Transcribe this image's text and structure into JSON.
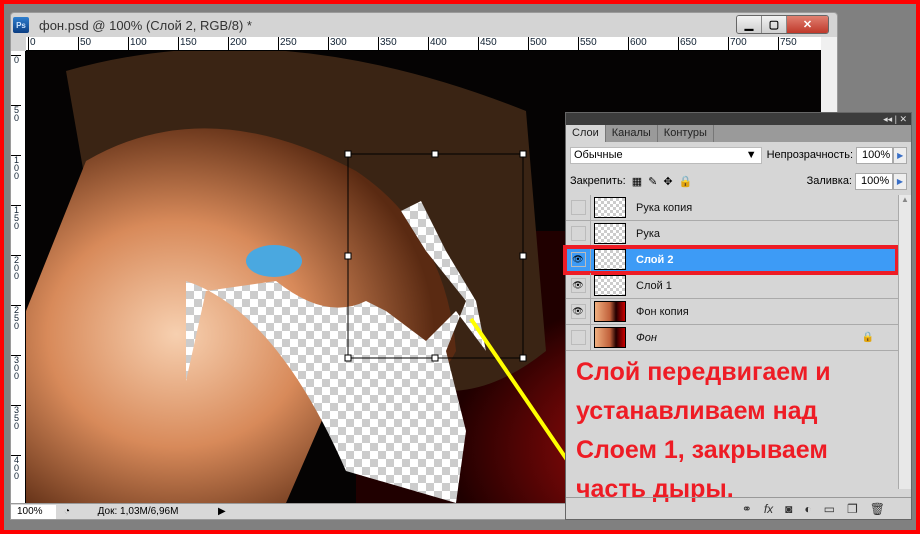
{
  "window": {
    "title": "фон.psd @ 100% (Слой 2, RGB/8) *",
    "app_icon": "Ps"
  },
  "ruler_top": [
    "0",
    "50",
    "100",
    "150",
    "200",
    "250",
    "300",
    "350",
    "400",
    "450",
    "500",
    "550",
    "600",
    "650",
    "700",
    "750"
  ],
  "ruler_left": [
    "0",
    "50",
    "100",
    "150",
    "200",
    "250",
    "300",
    "350",
    "400"
  ],
  "status": {
    "zoom": "100%",
    "doc": "Док: 1,03M/6,96M"
  },
  "panel": {
    "tabs": [
      "Слои",
      "Каналы",
      "Контуры"
    ],
    "blend_mode": "Обычные",
    "opacity_label": "Непрозрачность:",
    "opacity": "100%",
    "lock_label": "Закрепить:",
    "fill_label": "Заливка:",
    "fill": "100%",
    "layers": [
      {
        "name": "Рука копия",
        "visible": false
      },
      {
        "name": "Рука",
        "visible": false
      },
      {
        "name": "Слой 2",
        "visible": true,
        "selected": true
      },
      {
        "name": "Слой 1",
        "visible": true
      },
      {
        "name": "Фон копия",
        "visible": true
      },
      {
        "name": "Фон",
        "visible": false,
        "locked": true
      }
    ]
  },
  "annotation": {
    "lines": [
      "Слой передвигаем и",
      "устанавливаем над",
      "Слоем 1, закрываем",
      "часть дыры."
    ],
    "color": "#ee1c25",
    "arrow_color": "#ffff00"
  },
  "colors": {
    "selection": "#3d9bf6",
    "highlight_frame": "#ee1c25"
  }
}
